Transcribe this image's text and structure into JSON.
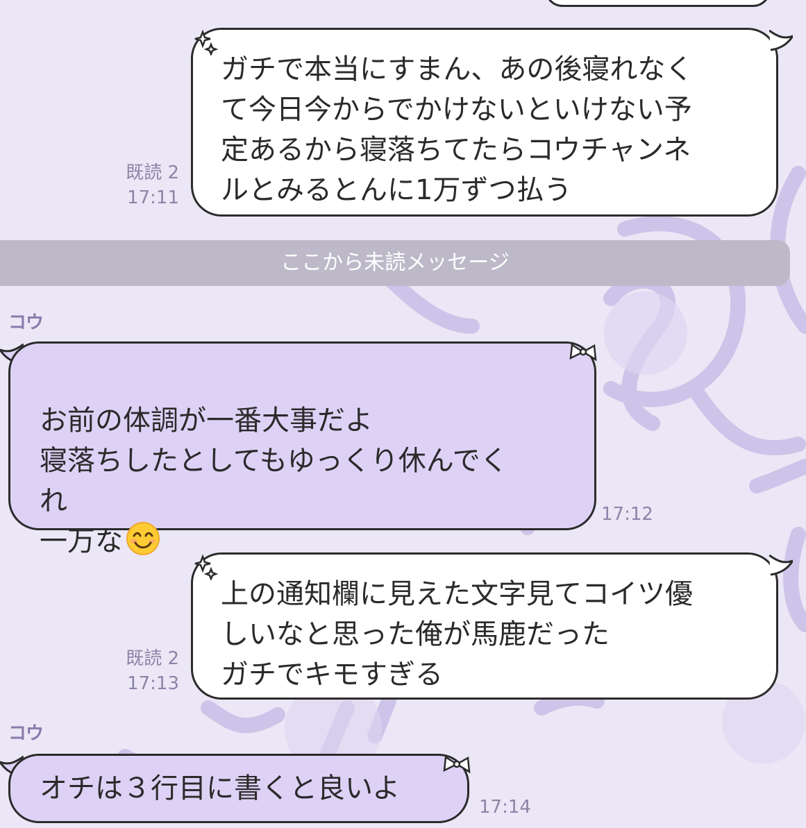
{
  "messages": [
    {
      "sender": "self",
      "read": "既読 2",
      "time": "17:11",
      "text": "ガチで本当にすまん、あの後寝れなく\nて今日今からでかけないといけない予\n定あるから寝落ちてたらコウチャンネ\nルとみるとんに1万ずつ払う"
    },
    {
      "sender": "コウ",
      "time": "17:12",
      "text": "お前の体調が一番大事だよ\n寝落ちしたとしてもゆっくり休んでく\nれ\n一万な",
      "emoji": "smiling-face-emoji"
    },
    {
      "sender": "self",
      "read": "既読 2",
      "time": "17:13",
      "text": "上の通知欄に見えた文字見てコイツ優\nしいなと思った俺が馬鹿だった\nガチでキモすぎる"
    },
    {
      "sender": "コウ",
      "time": "17:14",
      "text": "オチは３行目に書くと良いよ"
    }
  ],
  "unread_divider": "ここから未読メッセージ",
  "colors": {
    "background": "#ebe7f6",
    "incoming_bubble": "#ddd2f6",
    "outgoing_bubble": "#ffffff",
    "meta_text": "#8c84a8"
  }
}
